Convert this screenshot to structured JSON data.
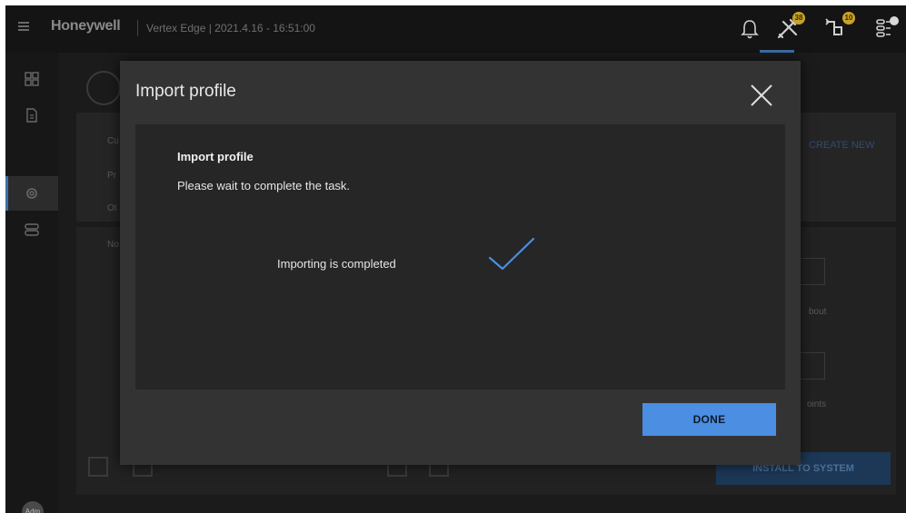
{
  "header": {
    "brand": "Honeywell",
    "subtitle": "Vertex Edge | 2021.4.16 - 16:51:00",
    "badges": [
      "38",
      "10"
    ],
    "icons": [
      "menu-icon",
      "bell-icon",
      "tools-icon",
      "fitting-icon",
      "sliders-icon"
    ]
  },
  "sidebar": {
    "icons": [
      "dashboard-icon",
      "document-icon",
      "settings-icon",
      "modules-icon"
    ],
    "avatar_label": "Adm"
  },
  "background": {
    "card_title_fragment": "Cu",
    "row1_fragment": "Pr",
    "row2_fragment": "Ot",
    "row3_fragment": "No",
    "link_fragment": "CREATE NEW",
    "tile1_fragment": "bout",
    "tile2_fragment": "oints",
    "install_label": "INSTALL TO SYSTEM"
  },
  "modal": {
    "title": "Import profile",
    "body_heading": "Import profile",
    "body_text": "Please wait to complete the task.",
    "status_text": "Importing is completed",
    "done_label": "DONE"
  },
  "colors": {
    "accent": "#4b8ee2",
    "check": "#4b8ee2",
    "badge": "#c9a227"
  }
}
